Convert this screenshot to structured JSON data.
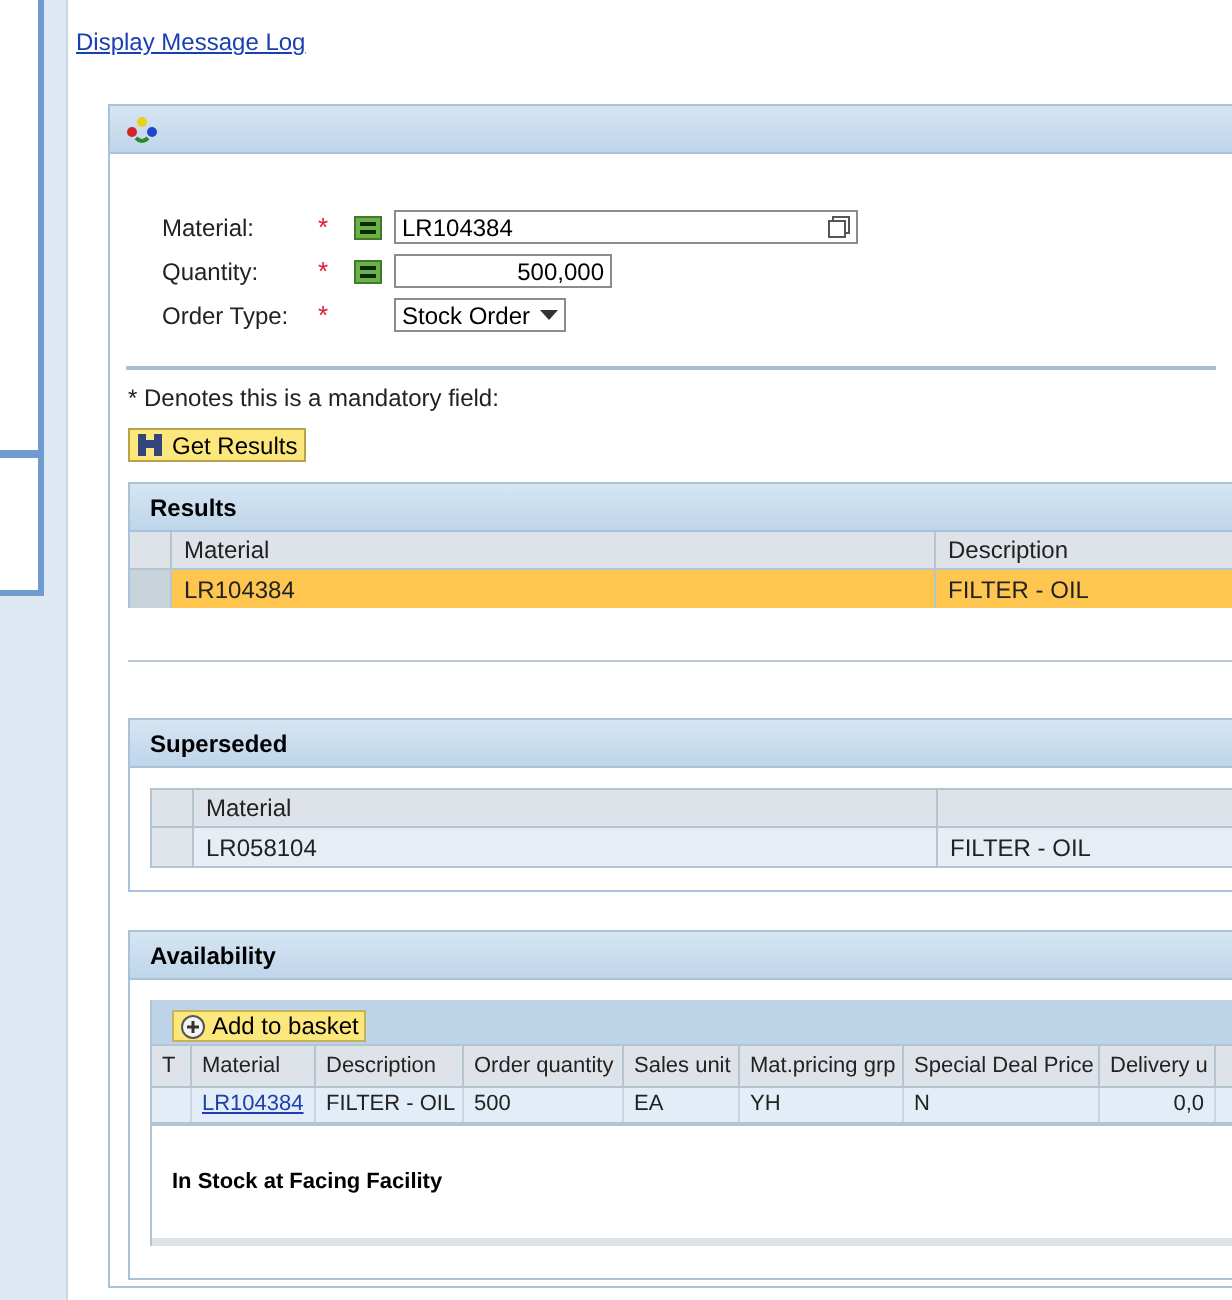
{
  "message_log_link": "Display Message Log",
  "form": {
    "fields": [
      {
        "kind": "text",
        "label": "Material:",
        "required_mark": "*",
        "value": "LR104384"
      },
      {
        "kind": "number",
        "label": "Quantity:",
        "required_mark": "*",
        "value": "500,000"
      },
      {
        "kind": "select",
        "label": "Order Type:",
        "required_mark": "*",
        "value": "Stock Order"
      }
    ],
    "mandatory_note": "* Denotes this is a mandatory field:",
    "get_results_button": "Get Results"
  },
  "results": {
    "title": "Results",
    "columns": [
      "Material",
      "Description"
    ],
    "rows": [
      {
        "cells": [
          "LR104384",
          "FILTER - OIL"
        ],
        "selected": true
      }
    ]
  },
  "superseded": {
    "title": "Superseded",
    "columns": [
      "Material"
    ],
    "rows": [
      {
        "cells": [
          "LR058104",
          "FILTER - OIL"
        ],
        "selected": false
      }
    ]
  },
  "availability": {
    "title": "Availability",
    "add_button": "Add to basket",
    "columns": [
      "T",
      "Material",
      "Description",
      "Order quantity",
      "Sales unit",
      "Mat.pricing grp",
      "Special Deal Price",
      "Delivery u"
    ],
    "rows": [
      {
        "cells": [
          "",
          "LR104384",
          "FILTER - OIL",
          "500",
          "EA",
          "YH",
          "N",
          "0,0"
        ],
        "selected": false
      }
    ],
    "status_text": "In Stock at Facing Facility"
  }
}
